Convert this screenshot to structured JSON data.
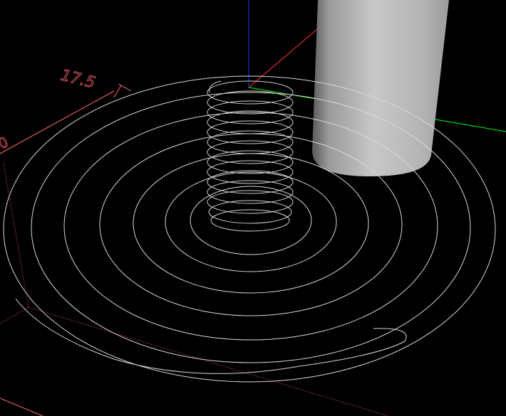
{
  "viewport": {
    "background": "#000000",
    "axes": {
      "x_color": "#00ff00",
      "y_color": "#ff3030",
      "z_color": "#2a2aff"
    },
    "wire_color": "#d8d8d8",
    "dim_color": "#ff6a6a",
    "cylinder": {
      "light": "#d6d6d6",
      "mid": "#a8a8a8",
      "dark": "#5c5c5c"
    },
    "dimension_label": "17.5",
    "partial_label": "0"
  }
}
